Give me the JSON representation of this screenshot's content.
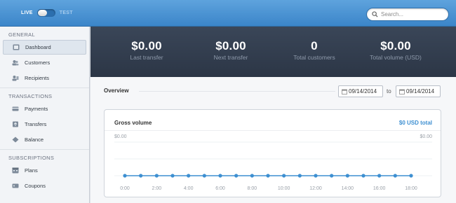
{
  "header": {
    "mode_live": "LIVE",
    "mode_test": "TEST",
    "search_placeholder": "Search..."
  },
  "sidebar": {
    "sections": [
      {
        "title": "GENERAL",
        "items": [
          {
            "label": "Dashboard",
            "icon": "dashboard-icon",
            "active": true
          },
          {
            "label": "Customers",
            "icon": "customers-icon"
          },
          {
            "label": "Recipients",
            "icon": "recipients-icon"
          }
        ]
      },
      {
        "title": "TRANSACTIONS",
        "items": [
          {
            "label": "Payments",
            "icon": "payments-icon"
          },
          {
            "label": "Transfers",
            "icon": "transfers-icon"
          },
          {
            "label": "Balance",
            "icon": "balance-icon"
          }
        ]
      },
      {
        "title": "SUBSCRIPTIONS",
        "items": [
          {
            "label": "Plans",
            "icon": "plans-icon"
          },
          {
            "label": "Coupons",
            "icon": "coupons-icon"
          }
        ]
      }
    ]
  },
  "stats": [
    {
      "value": "$0.00",
      "label": "Last transfer"
    },
    {
      "value": "$0.00",
      "label": "Next transfer"
    },
    {
      "value": "0",
      "label": "Total customers"
    },
    {
      "value": "$0.00",
      "label": "Total volume (USD)"
    }
  ],
  "overview": {
    "title": "Overview",
    "date_from": "09/14/2014",
    "to_label": "to",
    "date_to": "09/14/2014"
  },
  "gross_volume": {
    "title": "Gross volume",
    "total": "$0 USD total"
  },
  "colors": {
    "accent": "#3d8fd1",
    "header_blue": "#4a93d3",
    "banner_dark": "#323d4e"
  },
  "chart_data": {
    "type": "line",
    "y_labels_left": "$0.00",
    "y_labels_right": "$0.00",
    "x_tick_labels": [
      "0:00",
      "2:00",
      "4:00",
      "6:00",
      "8:00",
      "10:00",
      "12:00",
      "14:00",
      "16:00",
      "18:00"
    ],
    "series": [
      {
        "x": [
          0,
          1,
          2,
          3,
          4,
          5,
          6,
          7,
          8,
          9,
          10,
          11,
          12,
          13,
          14,
          15,
          16,
          17,
          18
        ],
        "values": [
          0,
          0,
          0,
          0,
          0,
          0,
          0,
          0,
          0,
          0,
          0,
          0,
          0,
          0,
          0,
          0,
          0,
          0,
          0
        ]
      }
    ],
    "grid": true
  }
}
